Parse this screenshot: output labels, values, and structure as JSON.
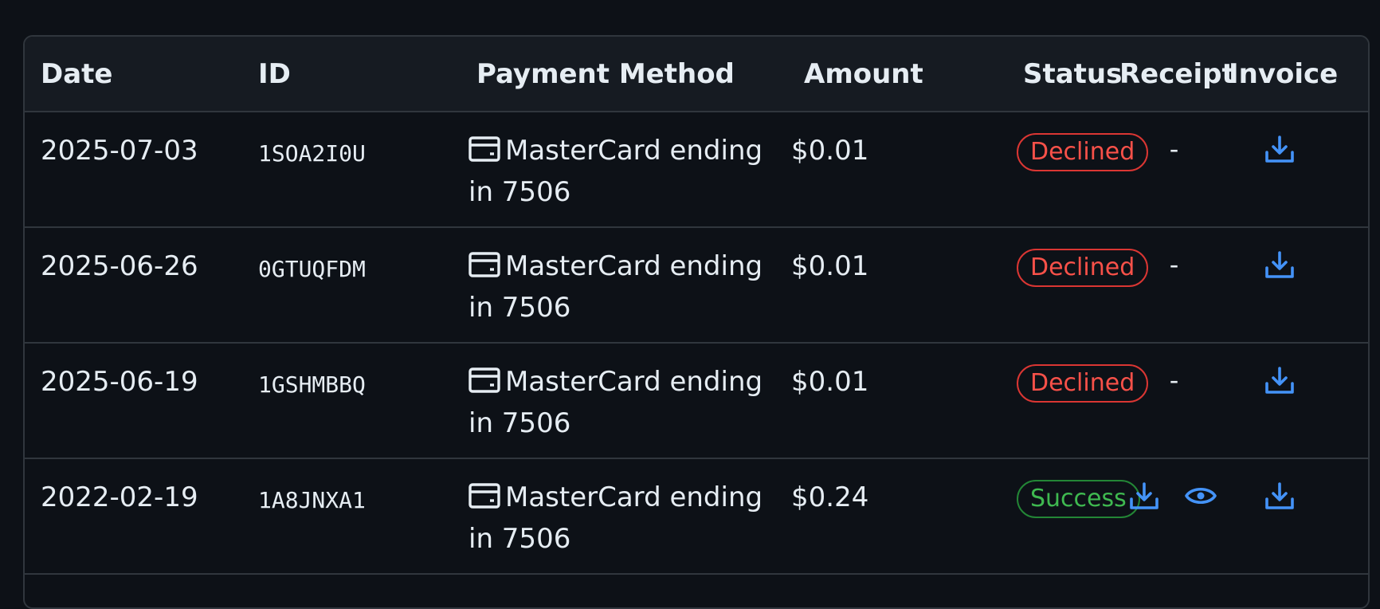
{
  "table": {
    "headers": {
      "date": "Date",
      "id": "ID",
      "payment_method": "Payment Method",
      "amount": "Amount",
      "status": "Status",
      "receipt": "Receipt",
      "invoice": "Invoice"
    },
    "rows": [
      {
        "date": "2025-07-03",
        "id": "1SOA2I0U",
        "payment_icon": "credit-card-icon",
        "payment_method": "MasterCard ending in 7506",
        "amount": "$0.01",
        "status": "Declined",
        "status_type": "declined",
        "receipt": "-",
        "invoice_icon": "download-icon"
      },
      {
        "date": "2025-06-26",
        "id": "0GTUQFDM",
        "payment_icon": "credit-card-icon",
        "payment_method": "MasterCard ending in 7506",
        "amount": "$0.01",
        "status": "Declined",
        "status_type": "declined",
        "receipt": "-",
        "invoice_icon": "download-icon"
      },
      {
        "date": "2025-06-19",
        "id": "1GSHMBBQ",
        "payment_icon": "credit-card-icon",
        "payment_method": "MasterCard ending in 7506",
        "amount": "$0.01",
        "status": "Declined",
        "status_type": "declined",
        "receipt": "-",
        "invoice_icon": "download-icon"
      },
      {
        "date": "2022-02-19",
        "id": "1A8JNXA1",
        "payment_icon": "credit-card-icon",
        "payment_method": "MasterCard ending in 7506",
        "amount": "$0.24",
        "status": "Success",
        "status_type": "success",
        "receipt_icons": [
          "download-icon",
          "eye-icon"
        ],
        "invoice_icon": "download-icon"
      }
    ]
  },
  "colors": {
    "background": "#0d1117",
    "header_background": "#161b22",
    "border": "#30363d",
    "text": "#e6edf3",
    "declined": "#f85149",
    "success": "#3fb950",
    "action_icon": "#4493f8"
  }
}
